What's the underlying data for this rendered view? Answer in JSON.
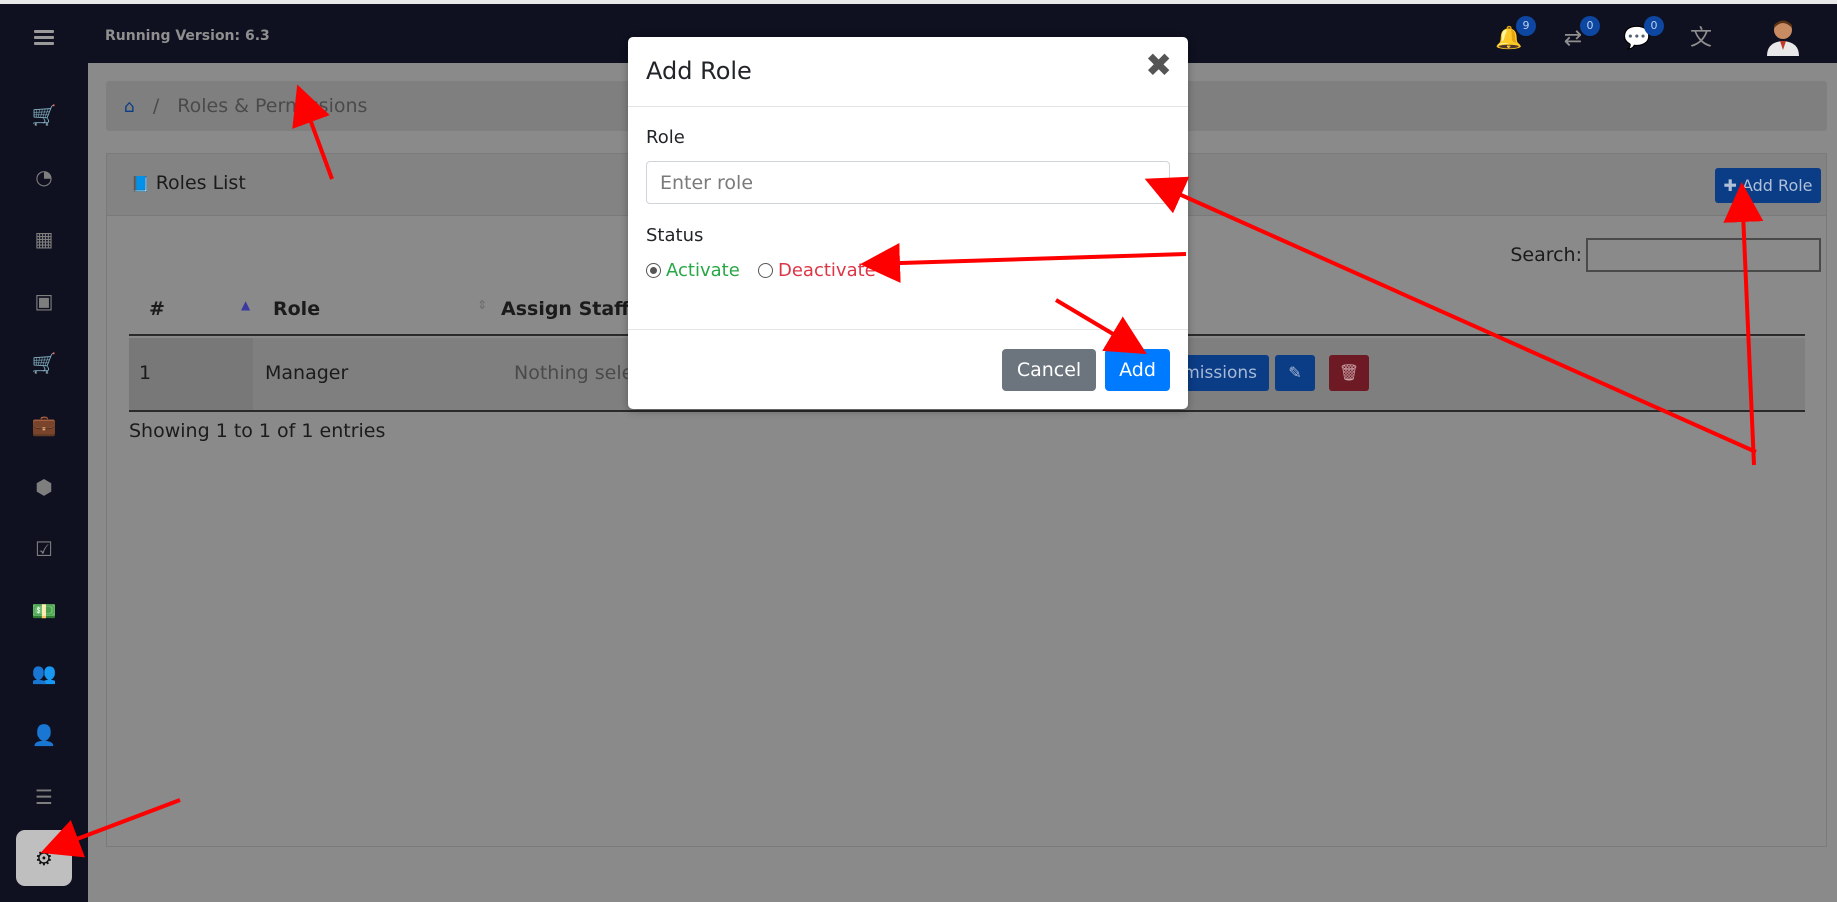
{
  "topbar": {
    "version_label": "Running Version: 6.3",
    "icons": [
      {
        "name": "bell-icon",
        "glyph": "🔔",
        "badge": "9"
      },
      {
        "name": "transfer-icon",
        "glyph": "⇄",
        "badge": "0"
      },
      {
        "name": "chat-icon",
        "glyph": "💬",
        "badge": "0"
      },
      {
        "name": "translate-icon",
        "glyph": "文"
      }
    ]
  },
  "sidebar": {
    "items": [
      {
        "name": "cart-icon",
        "glyph": "🛒"
      },
      {
        "name": "dashboard-icon",
        "glyph": "◔"
      },
      {
        "name": "calendar-icon",
        "glyph": "▦"
      },
      {
        "name": "calendar-plus-icon",
        "glyph": "▣"
      },
      {
        "name": "cart-icon",
        "glyph": "🛒"
      },
      {
        "name": "briefcase-icon",
        "glyph": "💼"
      },
      {
        "name": "cubes-icon",
        "glyph": "⬢"
      },
      {
        "name": "calendar-check-icon",
        "glyph": "☑"
      },
      {
        "name": "money-icon",
        "glyph": "💵"
      },
      {
        "name": "users-icon",
        "glyph": "👥"
      },
      {
        "name": "user-icon",
        "glyph": "👤"
      },
      {
        "name": "list-icon",
        "glyph": "☰"
      },
      {
        "name": "settings-icon",
        "glyph": "⚙"
      }
    ]
  },
  "breadcrumb": {
    "home_glyph": "⌂",
    "separator": "/",
    "current": "Roles & Permissions"
  },
  "card": {
    "title_glyph": "📘",
    "title": "Roles List",
    "add_button": "✚ Add Role",
    "search_label": "Search:"
  },
  "table": {
    "headers": [
      "#",
      "Role",
      "Assign Staff"
    ],
    "rows": [
      {
        "num": "1",
        "role": "Manager",
        "assign": "Nothing selec",
        "perm_button": "missions",
        "edit_glyph": "✎",
        "delete_glyph": "🗑"
      }
    ],
    "showing": "Showing 1 to 1 of 1 entries"
  },
  "modal": {
    "title": "Add Role",
    "close": "✖",
    "role_label": "Role",
    "role_placeholder": "Enter role",
    "status_label": "Status",
    "status_options": [
      {
        "label": "Activate",
        "checked": true,
        "color": "#28a745"
      },
      {
        "label": "Deactivate",
        "checked": false,
        "color": "#dc3545"
      }
    ],
    "cancel_label": "Cancel",
    "add_label": "Add"
  },
  "colors": {
    "topbar": "#0f1020",
    "primary": "#007bff",
    "annotation": "#ff0000"
  }
}
